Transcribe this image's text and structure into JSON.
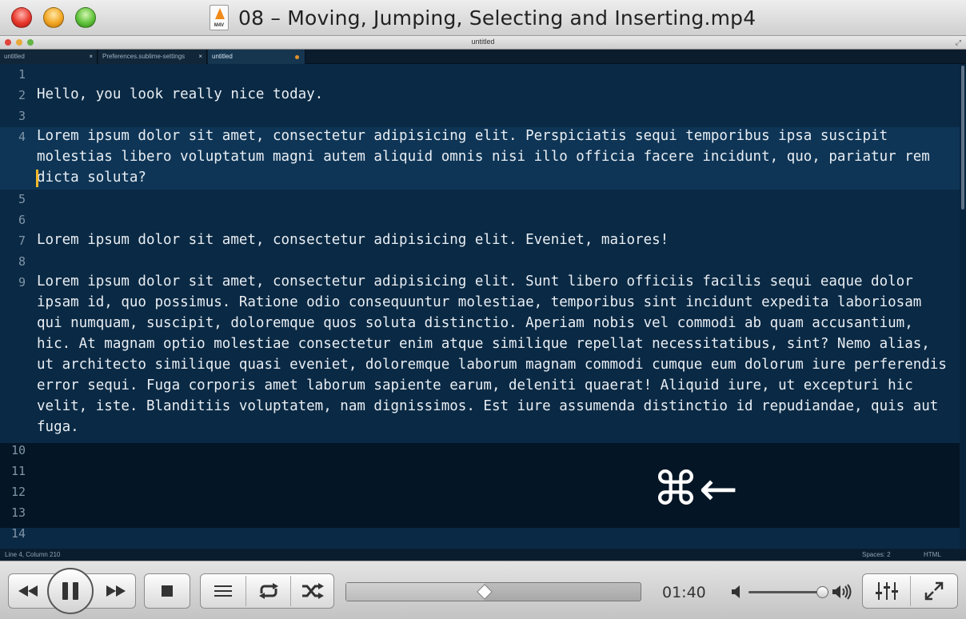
{
  "window": {
    "title": "08 – Moving, Jumping, Selecting and Inserting.mp4",
    "file_icon_label": "M4V"
  },
  "sublime": {
    "window_title": "untitled",
    "tabs": [
      {
        "label": "untitled",
        "state": "close"
      },
      {
        "label": "Preferences.sublime-settings",
        "state": "close"
      },
      {
        "label": "untitled",
        "state": "dirty",
        "active": true
      }
    ],
    "close_glyph": "×",
    "lines": [
      {
        "num": "1",
        "text": ""
      },
      {
        "num": "2",
        "text": "Hello, you look really nice today."
      },
      {
        "num": "3",
        "text": ""
      },
      {
        "num": "4",
        "text": "Lorem ipsum dolor sit amet, consectetur adipisicing elit. Perspiciatis sequi temporibus ipsa suscipit",
        "wrap": [
          "molestias libero voluptatum magni autem aliquid omnis nisi illo officia facere incidunt, quo, pariatur rem",
          "dicta soluta?"
        ]
      },
      {
        "num": "5",
        "text": ""
      },
      {
        "num": "6",
        "text": ""
      },
      {
        "num": "7",
        "text": "Lorem ipsum dolor sit amet, consectetur adipisicing elit. Eveniet, maiores!"
      },
      {
        "num": "8",
        "text": ""
      },
      {
        "num": "9",
        "text": "Lorem ipsum dolor sit amet, consectetur adipisicing elit. Sunt libero officiis facilis sequi eaque dolor",
        "wrap": [
          "ipsam id, quo possimus. Ratione odio consequuntur molestiae, temporibus sint incidunt expedita laboriosam",
          "qui numquam, suscipit, doloremque quos soluta distinctio. Aperiam nobis vel commodi ab quam accusantium,",
          "hic. At magnam optio molestiae consectetur enim atque similique repellat necessitatibus, sint? Nemo alias,",
          "ut architecto similique quasi eveniet, doloremque laborum magnam commodi cumque eum dolorum iure perferendis",
          "error sequi. Fuga corporis amet laborum sapiente earum, deleniti quaerat! Aliquid iure, ut excepturi hic",
          "velit, iste. Blanditiis voluptatem, nam dignissimos. Est iure assumenda distinctio id repudiandae, quis aut",
          "fuga."
        ]
      },
      {
        "num": "10",
        "text": ""
      },
      {
        "num": "11",
        "text": ""
      },
      {
        "num": "12",
        "text": ""
      },
      {
        "num": "13",
        "text": ""
      },
      {
        "num": "14",
        "text": ""
      }
    ],
    "overlay_keys": "⌘←",
    "status": {
      "position": "Line 4, Column 210",
      "indent": "Spaces: 2",
      "syntax": "HTML"
    },
    "colors": {
      "background": "#08243d",
      "highlight": "#0e3556",
      "caret": "#f2b829",
      "dark_band": "#041525"
    }
  },
  "player": {
    "time": "01:40",
    "progress_fraction": 0.47,
    "volume_fraction": 0.92,
    "buttons": {
      "rewind": "rewind-icon",
      "pause": "pause-icon",
      "fast_forward": "fast-forward-icon",
      "stop": "stop-icon",
      "playlist": "playlist-icon",
      "repeat": "repeat-icon",
      "shuffle": "shuffle-icon",
      "equalizer": "equalizer-icon",
      "fullscreen": "fullscreen-icon"
    }
  }
}
